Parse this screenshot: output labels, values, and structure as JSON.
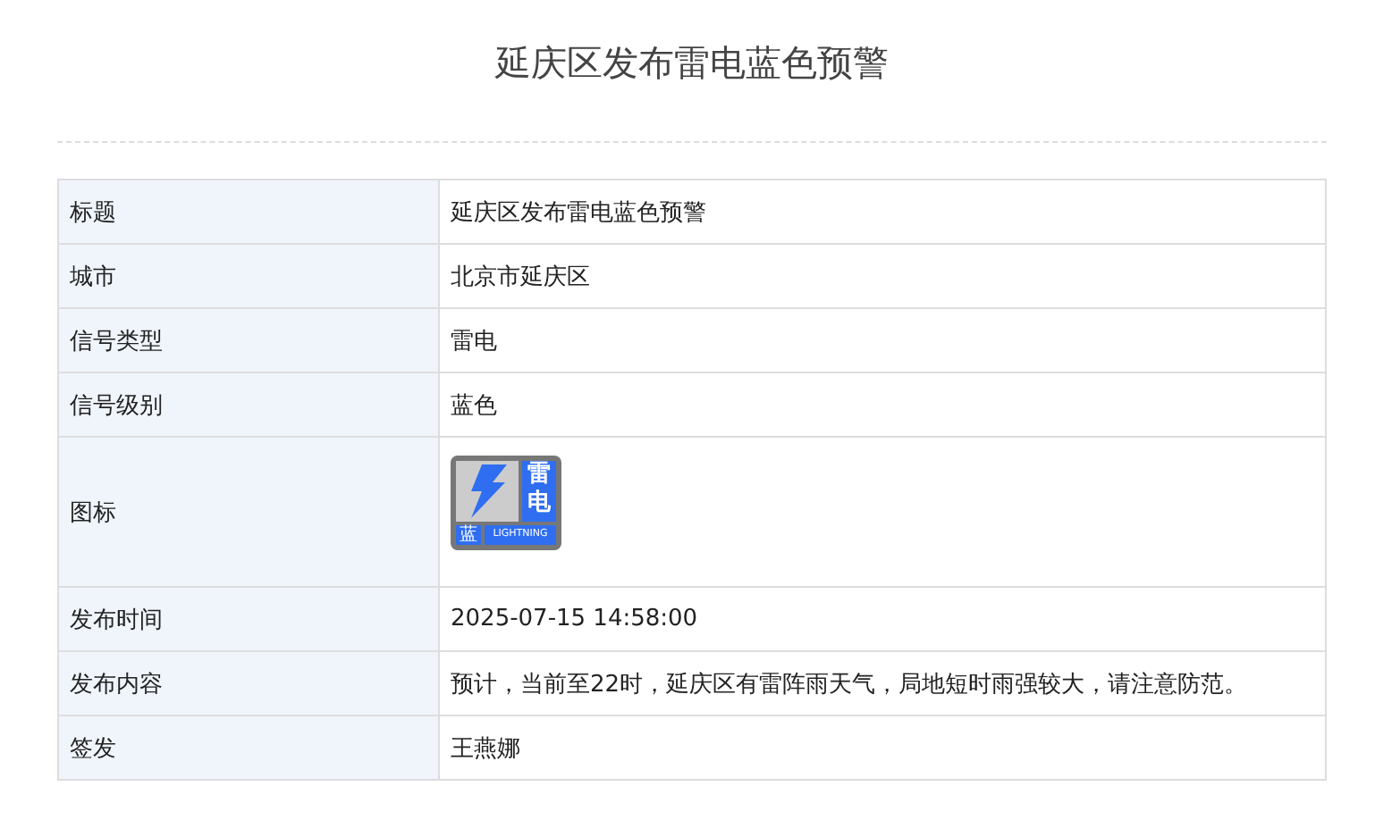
{
  "title": "延庆区发布雷电蓝色预警",
  "rows": [
    {
      "kind": "text",
      "label": "标题",
      "value": "延庆区发布雷电蓝色预警"
    },
    {
      "kind": "text",
      "label": "城市",
      "value": "北京市延庆区"
    },
    {
      "kind": "text",
      "label": "信号类型",
      "value": "雷电"
    },
    {
      "kind": "text",
      "label": "信号级别",
      "value": "蓝色"
    },
    {
      "kind": "icon",
      "label": "图标",
      "icon": {
        "type": "雷电",
        "level": "蓝",
        "caption": "LIGHTNING",
        "color": "#2f6ef0"
      }
    },
    {
      "kind": "text",
      "label": "发布时间",
      "value": "2025-07-15 14:58:00"
    },
    {
      "kind": "text",
      "label": "发布内容",
      "value": "预计，当前至22时，延庆区有雷阵雨天气，局地短时雨强较大，请注意防范。"
    },
    {
      "kind": "text",
      "label": "签发",
      "value": "王燕娜"
    }
  ]
}
